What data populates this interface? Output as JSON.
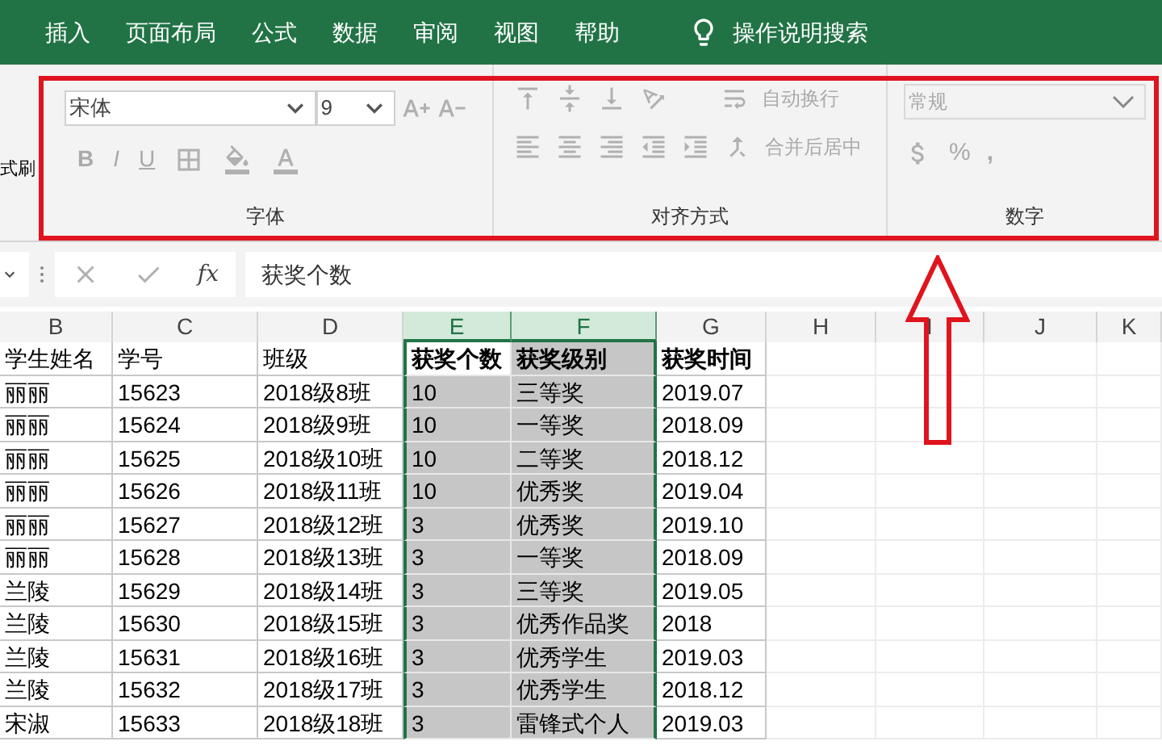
{
  "ribbon": {
    "tabs": [
      {
        "label": "插入",
        "selected": false
      },
      {
        "label": "页面布局",
        "selected": false
      },
      {
        "label": "公式",
        "selected": false
      },
      {
        "label": "数据",
        "selected": false
      },
      {
        "label": "审阅",
        "selected": false
      },
      {
        "label": "视图",
        "selected": false
      },
      {
        "label": "帮助",
        "selected": false
      }
    ],
    "search_label": "操作说明搜索",
    "clipboard_fragment": "式刷",
    "font": {
      "label": "字体",
      "font_name": "宋体",
      "font_size": "9",
      "style_buttons": [
        "B",
        "I",
        "U"
      ]
    },
    "alignment": {
      "label": "对齐方式",
      "wrap_text": "自动换行",
      "merge_center": "合并后居中"
    },
    "number": {
      "label": "数字",
      "format": "常规",
      "percent": "%",
      "comma": ","
    }
  },
  "formula_bar": {
    "fx": "fx",
    "value": "获奖个数"
  },
  "sheet": {
    "columns": [
      {
        "label": "B",
        "selected": false
      },
      {
        "label": "C",
        "selected": false
      },
      {
        "label": "D",
        "selected": false
      },
      {
        "label": "E",
        "selected": true
      },
      {
        "label": "F",
        "selected": true
      },
      {
        "label": "G",
        "selected": false
      },
      {
        "label": "H",
        "selected": false
      },
      {
        "label": "I",
        "selected": false
      },
      {
        "label": "J",
        "selected": false
      },
      {
        "label": "K",
        "selected": false
      }
    ],
    "header_row": [
      {
        "text": "学生姓名",
        "bold": false
      },
      {
        "text": "学号",
        "bold": false
      },
      {
        "text": "班级",
        "bold": false
      },
      {
        "text": "获奖个数",
        "bold": true,
        "active": true
      },
      {
        "text": "获奖级别",
        "bold": true,
        "active": false
      },
      {
        "text": "获奖时间",
        "bold": true
      }
    ],
    "rows": [
      [
        "丽丽",
        "15623",
        "2018级8班",
        "10",
        "三等奖",
        "2019.07"
      ],
      [
        "丽丽",
        "15624",
        "2018级9班",
        "10",
        "一等奖",
        "2018.09"
      ],
      [
        "丽丽",
        "15625",
        "2018级10班",
        "10",
        "二等奖",
        "2018.12"
      ],
      [
        "丽丽",
        "15626",
        "2018级11班",
        "10",
        "优秀奖",
        "2019.04"
      ],
      [
        "丽丽",
        "15627",
        "2018级12班",
        "3",
        "优秀奖",
        "2019.10"
      ],
      [
        "丽丽",
        "15628",
        "2018级13班",
        "3",
        "一等奖",
        "2018.09"
      ],
      [
        "兰陵",
        "15629",
        "2018级14班",
        "3",
        "三等奖",
        "2019.05"
      ],
      [
        "兰陵",
        "15630",
        "2018级15班",
        "3",
        "优秀作品奖",
        "2018"
      ],
      [
        "兰陵",
        "15631",
        "2018级16班",
        "3",
        "优秀学生",
        "2019.03"
      ],
      [
        "兰陵",
        "15632",
        "2018级17班",
        "3",
        "优秀学生",
        "2018.12"
      ],
      [
        "宋淑",
        "15633",
        "2018级18班",
        "3",
        "雷锋式个人",
        "2019.03"
      ]
    ]
  }
}
